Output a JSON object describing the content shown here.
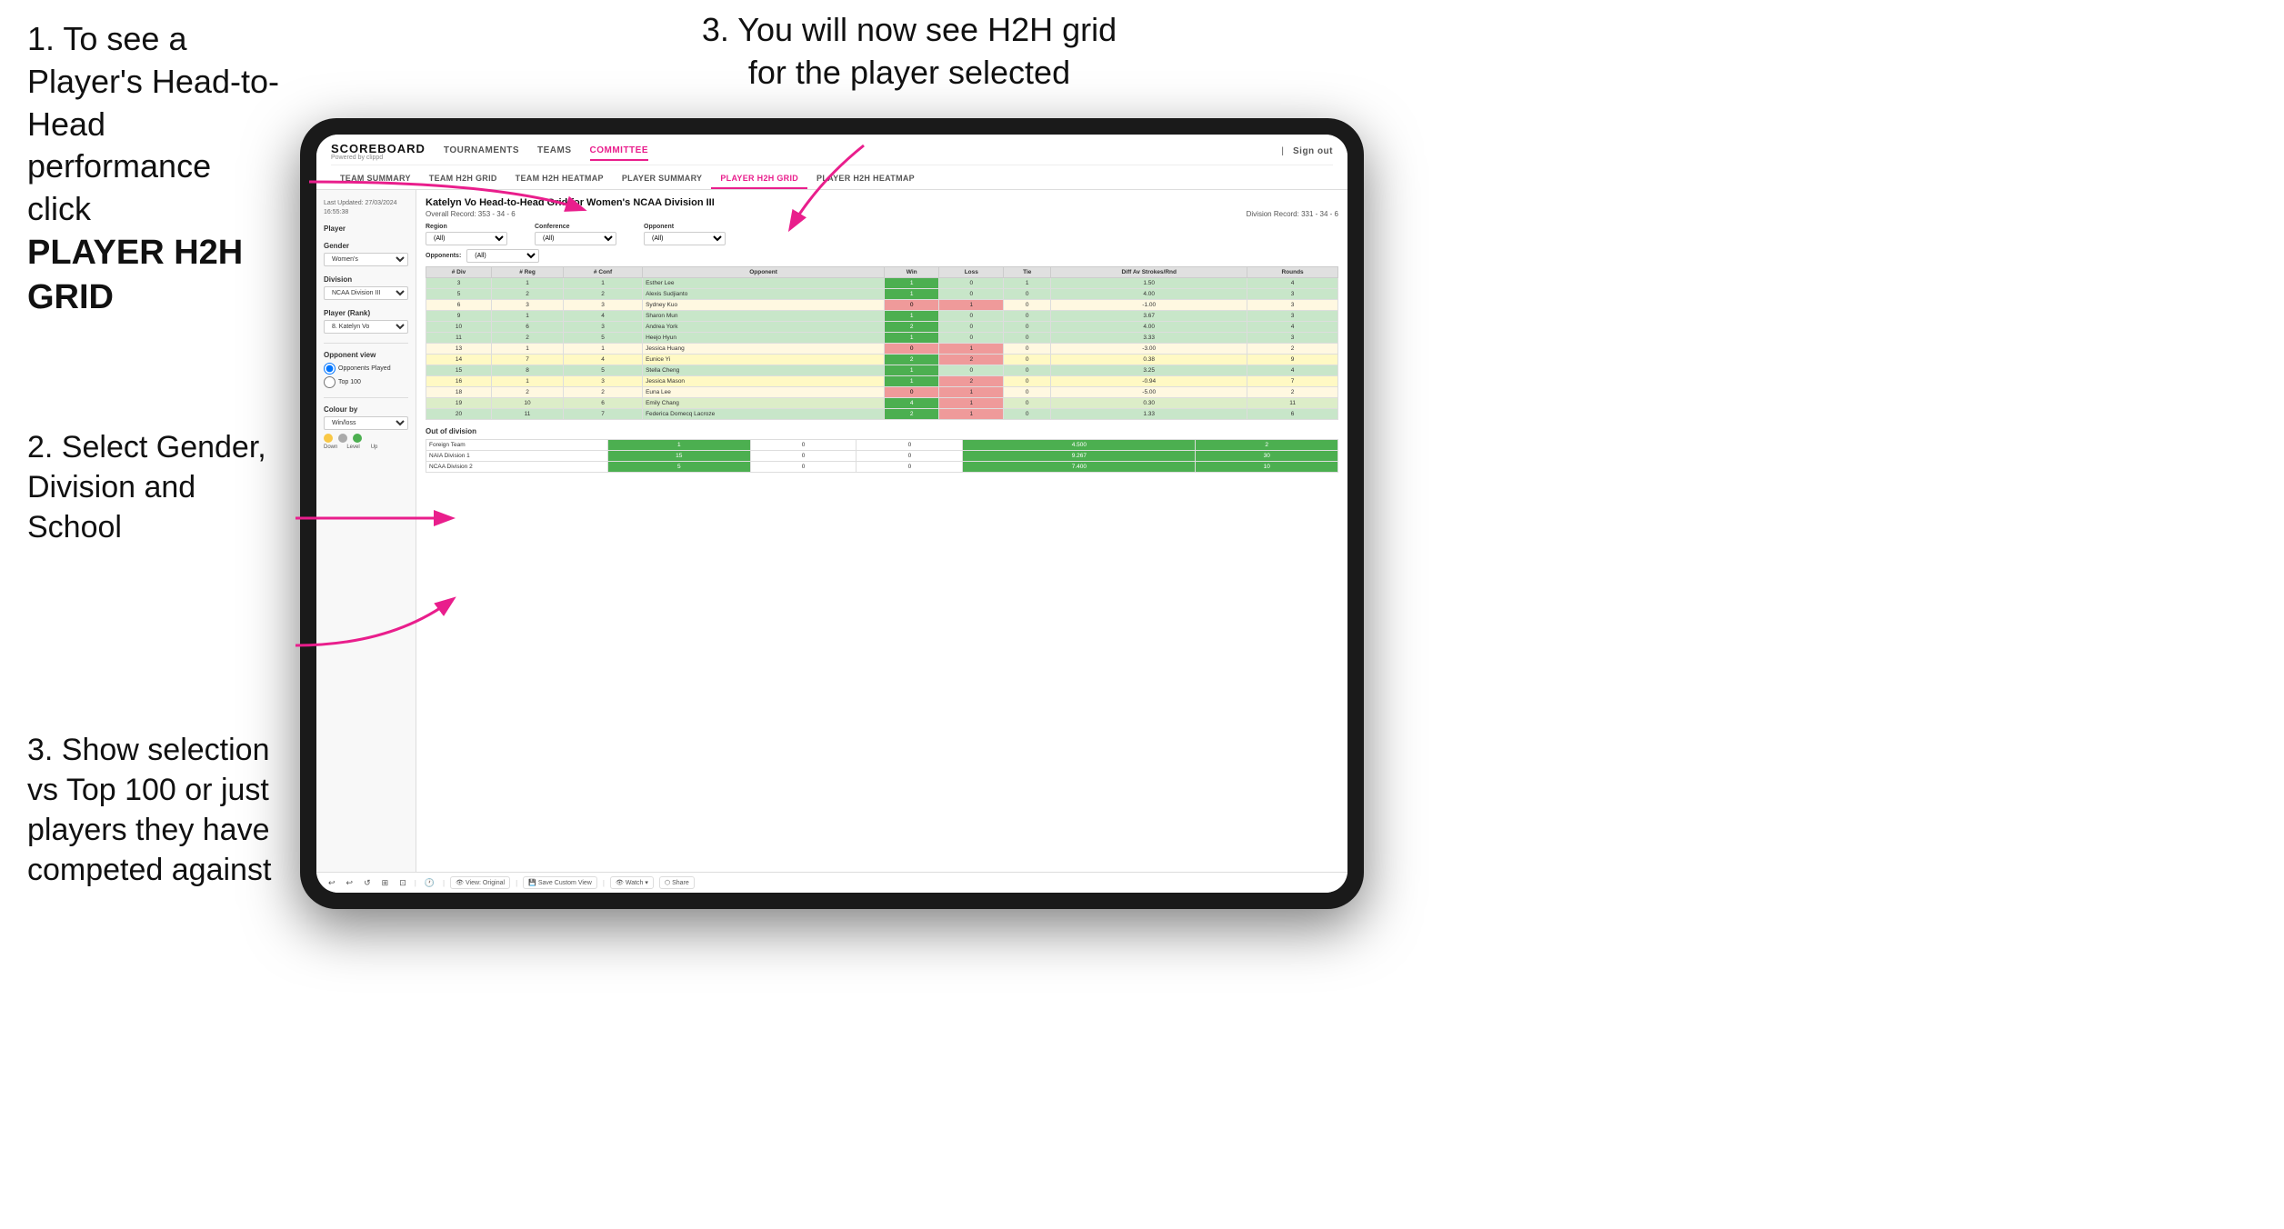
{
  "instructions": {
    "step1": "1. To see a Player's Head-to-Head performance click",
    "step1_bold": "PLAYER H2H GRID",
    "step2_title": "2. Select Gender, Division and School",
    "step3_top": "3. You will now see H2H grid for the player selected",
    "step3_bottom_title": "3. Show selection vs Top 100 or just players they have competed against"
  },
  "nav": {
    "logo": "SCOREBOARD",
    "logo_sub": "Powered by clippd",
    "items": [
      "TOURNAMENTS",
      "TEAMS",
      "COMMITTEE"
    ],
    "sign_out": "Sign out",
    "tabs": [
      "TEAM SUMMARY",
      "TEAM H2H GRID",
      "TEAM H2H HEATMAP",
      "PLAYER SUMMARY",
      "PLAYER H2H GRID",
      "PLAYER H2H HEATMAP"
    ]
  },
  "sidebar": {
    "timestamp": "Last Updated: 27/03/2024 16:55:38",
    "player_label": "Player",
    "gender_label": "Gender",
    "gender_value": "Women's",
    "division_label": "Division",
    "division_value": "NCAA Division III",
    "player_rank_label": "Player (Rank)",
    "player_rank_value": "8. Katelyn Vo",
    "opponent_view_label": "Opponent view",
    "radio1": "Opponents Played",
    "radio2": "Top 100",
    "colour_by_label": "Colour by",
    "colour_by_value": "Win/loss",
    "dot_labels": [
      "Down",
      "Level",
      "Up"
    ]
  },
  "grid": {
    "title": "Katelyn Vo Head-to-Head Grid for Women's NCAA Division III",
    "overall_record": "Overall Record: 353 - 34 - 6",
    "division_record": "Division Record: 331 - 34 - 6",
    "region_label": "Region",
    "conference_label": "Conference",
    "opponent_label": "Opponent",
    "opponents_label": "Opponents:",
    "opponents_filter": "(All)",
    "region_filter": "(All)",
    "conference_filter": "(All)",
    "opponent_filter": "(All)",
    "columns": [
      "# Div",
      "# Reg",
      "# Conf",
      "Opponent",
      "Win",
      "Loss",
      "Tie",
      "Diff Av Strokes/Rnd",
      "Rounds"
    ],
    "rows": [
      {
        "div": 3,
        "reg": 1,
        "conf": 1,
        "opponent": "Esther Lee",
        "win": 1,
        "loss": 0,
        "tie": 1,
        "diff": "1.50",
        "rounds": 4,
        "color": "green"
      },
      {
        "div": 5,
        "reg": 2,
        "conf": 2,
        "opponent": "Alexis Sudjianto",
        "win": 1,
        "loss": 0,
        "tie": 0,
        "diff": "4.00",
        "rounds": 3,
        "color": "green"
      },
      {
        "div": 6,
        "reg": 3,
        "conf": 3,
        "opponent": "Sydney Kuo",
        "win": 0,
        "loss": 1,
        "tie": 0,
        "diff": "-1.00",
        "rounds": 3,
        "color": "light-yellow"
      },
      {
        "div": 9,
        "reg": 1,
        "conf": 4,
        "opponent": "Sharon Mun",
        "win": 1,
        "loss": 0,
        "tie": 0,
        "diff": "3.67",
        "rounds": 3,
        "color": "green"
      },
      {
        "div": 10,
        "reg": 6,
        "conf": 3,
        "opponent": "Andrea York",
        "win": 2,
        "loss": 0,
        "tie": 0,
        "diff": "4.00",
        "rounds": 4,
        "color": "green"
      },
      {
        "div": 11,
        "reg": 2,
        "conf": 5,
        "opponent": "Heejo Hyun",
        "win": 1,
        "loss": 0,
        "tie": 0,
        "diff": "3.33",
        "rounds": 3,
        "color": "green"
      },
      {
        "div": 13,
        "reg": 1,
        "conf": 1,
        "opponent": "Jessica Huang",
        "win": 0,
        "loss": 1,
        "tie": 0,
        "diff": "-3.00",
        "rounds": 2,
        "color": "light-yellow"
      },
      {
        "div": 14,
        "reg": 7,
        "conf": 4,
        "opponent": "Eunice Yi",
        "win": 2,
        "loss": 2,
        "tie": 0,
        "diff": "0.38",
        "rounds": 9,
        "color": "yellow"
      },
      {
        "div": 15,
        "reg": 8,
        "conf": 5,
        "opponent": "Stella Cheng",
        "win": 1,
        "loss": 0,
        "tie": 0,
        "diff": "3.25",
        "rounds": 4,
        "color": "green"
      },
      {
        "div": 16,
        "reg": 1,
        "conf": 3,
        "opponent": "Jessica Mason",
        "win": 1,
        "loss": 2,
        "tie": 0,
        "diff": "-0.94",
        "rounds": 7,
        "color": "yellow"
      },
      {
        "div": 18,
        "reg": 2,
        "conf": 2,
        "opponent": "Euna Lee",
        "win": 0,
        "loss": 1,
        "tie": 0,
        "diff": "-5.00",
        "rounds": 2,
        "color": "light-yellow"
      },
      {
        "div": 19,
        "reg": 10,
        "conf": 6,
        "opponent": "Emily Chang",
        "win": 4,
        "loss": 1,
        "tie": 0,
        "diff": "0.30",
        "rounds": 11,
        "color": "light-green"
      },
      {
        "div": 20,
        "reg": 11,
        "conf": 7,
        "opponent": "Federica Domecq Lacroze",
        "win": 2,
        "loss": 1,
        "tie": 0,
        "diff": "1.33",
        "rounds": 6,
        "color": "green"
      }
    ],
    "out_of_division_title": "Out of division",
    "out_of_division_rows": [
      {
        "team": "Foreign Team",
        "win": 1,
        "loss": 0,
        "tie": 0,
        "diff": "4.500",
        "rounds": 2,
        "color": "green"
      },
      {
        "team": "NAIA Division 1",
        "win": 15,
        "loss": 0,
        "tie": 0,
        "diff": "9.267",
        "rounds": 30,
        "color": "green"
      },
      {
        "team": "NCAA Division 2",
        "win": 5,
        "loss": 0,
        "tie": 0,
        "diff": "7.400",
        "rounds": 10,
        "color": "green"
      }
    ]
  },
  "toolbar": {
    "view_original": "View: Original",
    "save_custom": "Save Custom View",
    "watch": "Watch",
    "share": "Share"
  }
}
